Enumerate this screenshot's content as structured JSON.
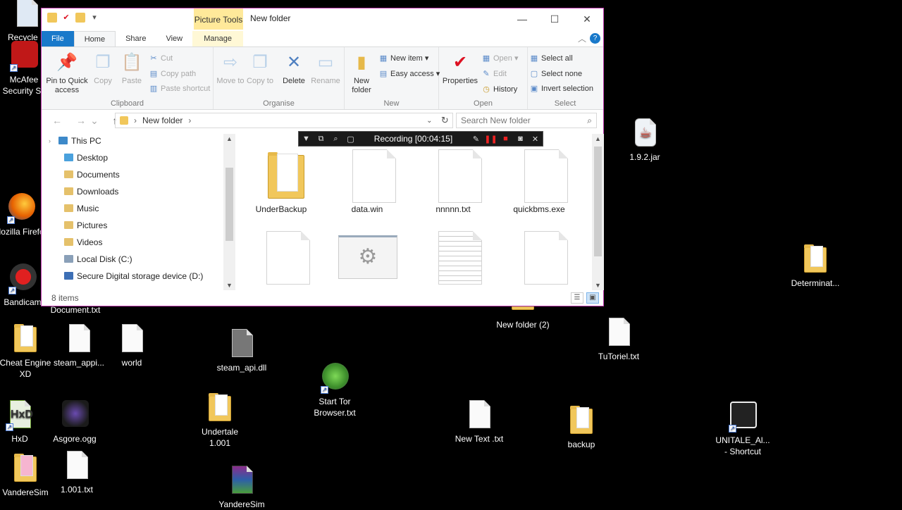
{
  "window": {
    "title": "New folder",
    "picture_tools": "Picture Tools",
    "minimize": "—",
    "maximize": "☐",
    "close": "✕"
  },
  "tabs": [
    {
      "label": "File"
    },
    {
      "label": "Home"
    },
    {
      "label": "Share"
    },
    {
      "label": "View"
    },
    {
      "label": "Manage"
    }
  ],
  "help": "?",
  "ribbon": {
    "clipboard": {
      "label": "Clipboard",
      "pin": "Pin to Quick access",
      "copy": "Copy",
      "paste": "Paste",
      "cut": "Cut",
      "copy_path": "Copy path",
      "paste_shortcut": "Paste shortcut"
    },
    "organise": {
      "label": "Organise",
      "move_to": "Move to",
      "copy_to": "Copy to",
      "delete": "Delete",
      "rename": "Rename"
    },
    "new": {
      "label": "New",
      "new_folder": "New folder",
      "new_item": "New item",
      "easy_access": "Easy access"
    },
    "open": {
      "label": "Open",
      "properties": "Properties",
      "open": "Open",
      "edit": "Edit",
      "history": "History"
    },
    "select": {
      "label": "Select",
      "select_all": "Select all",
      "select_none": "Select none",
      "invert": "Invert selection"
    }
  },
  "address": {
    "path": "New folder",
    "search_placeholder": "Search New folder"
  },
  "tree": [
    {
      "label": "This PC",
      "color": "#3d89c9"
    },
    {
      "label": "Desktop",
      "color": "#4aa1dd"
    },
    {
      "label": "Documents",
      "color": "#e5c16b"
    },
    {
      "label": "Downloads",
      "color": "#4a8fd8"
    },
    {
      "label": "Music",
      "color": "#e5c16b"
    },
    {
      "label": "Pictures",
      "color": "#e5c16b"
    },
    {
      "label": "Videos",
      "color": "#e5c16b"
    },
    {
      "label": "Local Disk (C:)",
      "color": "#8aa0b8"
    },
    {
      "label": "Secure Digital storage device (D:)",
      "color": "#3d6fb5"
    }
  ],
  "files": [
    {
      "name": "UnderBackup",
      "kind": "folder"
    },
    {
      "name": "data.win",
      "kind": "blank"
    },
    {
      "name": "nnnnn.txt",
      "kind": "blank"
    },
    {
      "name": "quickbms.exe",
      "kind": "blank"
    },
    {
      "name": "",
      "kind": "blank"
    },
    {
      "name": "",
      "kind": "gears"
    },
    {
      "name": "",
      "kind": "lines"
    },
    {
      "name": "",
      "kind": "blank"
    }
  ],
  "status": "8 items",
  "recording": {
    "text": "Recording [00:04:15]"
  },
  "desktop": [
    {
      "label": "Recycle B",
      "kind": "recycle"
    },
    {
      "label": "McAfee Security Sc",
      "kind": "mcafee"
    },
    {
      "label": "Mozilla Firefox",
      "kind": "firefox"
    },
    {
      "label": "Bandicam",
      "kind": "bandicam"
    },
    {
      "label": "Document.txt",
      "kind": "none"
    },
    {
      "label": "Cheat Engine XD",
      "kind": "folder"
    },
    {
      "label": "steam_appi...",
      "kind": "doc"
    },
    {
      "label": "world",
      "kind": "doc"
    },
    {
      "label": "steam_api.dll",
      "kind": "doc"
    },
    {
      "label": "Start Tor Browser.txt",
      "kind": "tor"
    },
    {
      "label": "HxD",
      "kind": "hxd"
    },
    {
      "label": "Asgore.ogg",
      "kind": "asgore"
    },
    {
      "label": "Undertale 1.001",
      "kind": "folder"
    },
    {
      "label": "VandereSim",
      "kind": "folder"
    },
    {
      "label": "1.001.txt",
      "kind": "doc"
    },
    {
      "label": "YandereSim",
      "kind": "winrar"
    },
    {
      "label": "New folder (2)",
      "kind": "folder"
    },
    {
      "label": "New Text .txt",
      "kind": "doc"
    },
    {
      "label": "backup",
      "kind": "folder"
    },
    {
      "label": "TuToriel.txt",
      "kind": "doc"
    },
    {
      "label": "1.9.2.jar",
      "kind": "java"
    },
    {
      "label": "Determinat...",
      "kind": "folder"
    },
    {
      "label": "UNITALE_Al... - Shortcut",
      "kind": "unity"
    }
  ]
}
